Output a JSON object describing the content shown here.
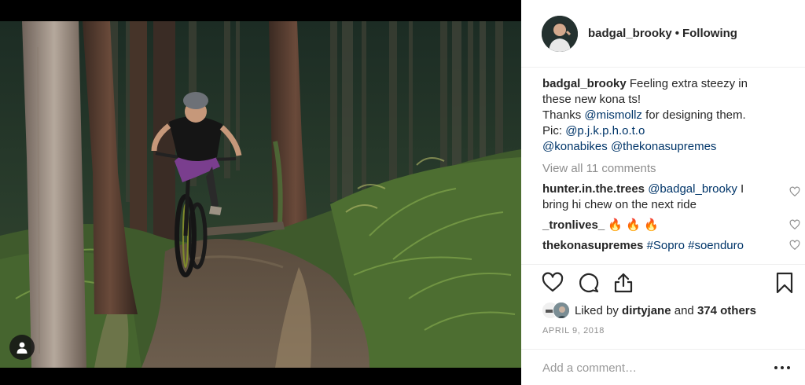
{
  "post": {
    "author": "badgal_brooky",
    "separator": "•",
    "follow_status": "Following",
    "caption": {
      "username": "badgal_brooky",
      "line1": "Feeling extra steezy in",
      "line2": "these new kona ts!",
      "line3_prefix": "Thanks",
      "mention1": "@mismollz",
      "line3_suffix": "for designing them.",
      "line4_prefix": "Pic:",
      "mention2": "@p.j.k.p.h.o.t.o",
      "mention3": "@konabikes",
      "mention4": "@thekonasupremes"
    },
    "view_all_comments": "View all 11 comments",
    "comments": [
      {
        "username": "hunter.in.the.trees",
        "mention": "@badgal_brooky",
        "text": "I bring hi chew on the next ride"
      },
      {
        "username": "_tronlives_",
        "text": "🔥 🔥 🔥"
      },
      {
        "username": "thekonasupremes",
        "hashtags": "#Sopro #soenduro"
      }
    ],
    "likes": {
      "prefix": "Liked by",
      "user": "dirtyjane",
      "middle": "and",
      "others": "374 others"
    },
    "date": "APRIL 9, 2018",
    "add_comment_placeholder": "Add a comment…"
  },
  "icons": {
    "user_tag": "person-icon",
    "like": "heart-outline-icon",
    "comment": "speech-bubble-icon",
    "share": "share-upload-icon",
    "save": "bookmark-icon",
    "more": "more-options-icon"
  },
  "colors": {
    "link": "#003569",
    "muted": "#8e8e8e",
    "text": "#262626"
  }
}
